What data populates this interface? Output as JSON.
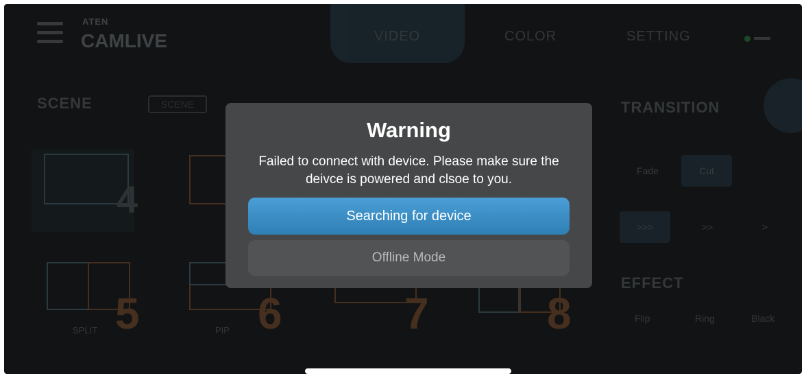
{
  "header": {
    "brand_small": "ATEN",
    "brand": "CAMLIVE",
    "tabs": [
      "VIDEO",
      "COLOR",
      "SETTING"
    ]
  },
  "scene": {
    "title": "SCENE",
    "toggle_label": "SCENE",
    "tiles": [
      {
        "number": "4",
        "label": ""
      },
      {
        "number": "",
        "label": ""
      },
      {
        "number": "5",
        "label": "SPLIT"
      },
      {
        "number": "6",
        "label": "PIP"
      },
      {
        "number": "7",
        "label": ""
      },
      {
        "number": "8",
        "label": ""
      }
    ]
  },
  "transition": {
    "title": "TRANSITION",
    "modes": [
      "Fade",
      "Cut"
    ],
    "speeds": [
      ">>>",
      ">>",
      ">"
    ],
    "effect_title": "EFFECT",
    "effects": [
      "Flip",
      "Ring",
      "Black"
    ]
  },
  "dialog": {
    "title": "Warning",
    "message": "Failed to connect with device. Please make sure the deivce is powered and clsoe to you.",
    "primary_button": "Searching for device",
    "secondary_button": "Offline Mode"
  },
  "colors": {
    "primary_button": "#3d8fc6",
    "dialog_bg": "#464749",
    "status_online": "#3dd15a"
  }
}
